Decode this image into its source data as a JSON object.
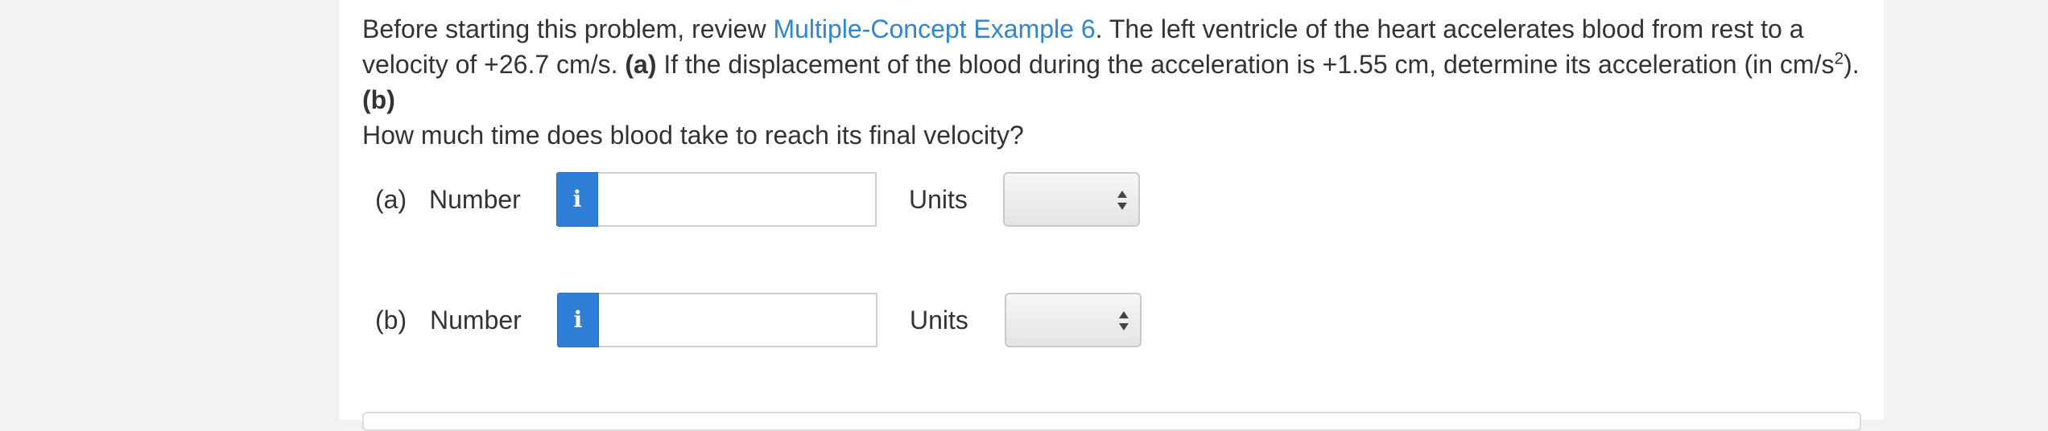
{
  "question": {
    "intro": "Before starting this problem, review ",
    "link_text": "Multiple-Concept Example 6",
    "text_1": ". The left ventricle of the heart accelerates blood from rest to a velocity of +26.7 cm/s. ",
    "part_a_marker": "(a)",
    "text_2": " If the displacement of the blood during the acceleration is +1.55 cm, determine its acceleration (in cm/s",
    "superscript": "2",
    "text_3": "). ",
    "part_b_marker": "(b)",
    "text_4": " How much time does blood take to reach its final velocity?"
  },
  "answers": [
    {
      "part": "(a)",
      "number_label": "Number",
      "info_icon_glyph": "i",
      "value": "",
      "units_label": "Units",
      "units_selected": ""
    },
    {
      "part": "(b)",
      "number_label": "Number",
      "info_icon_glyph": "i",
      "value": "",
      "units_label": "Units",
      "units_selected": ""
    }
  ],
  "colors": {
    "link": "#2e86d4",
    "info_button": "#2f7ed8",
    "text": "#333333"
  }
}
